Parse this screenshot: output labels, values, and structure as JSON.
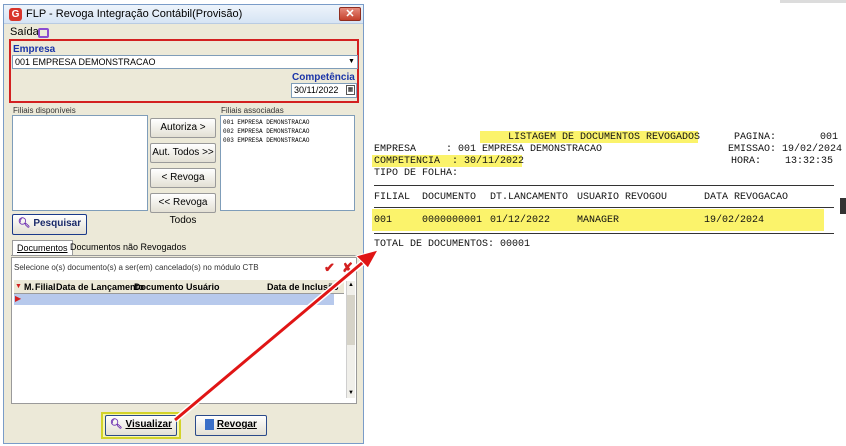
{
  "window": {
    "logo_letter": "G",
    "title": "FLP - Revoga Integração Contábil(Provisão)",
    "close_glyph": "✕",
    "menu_saida": "Saída"
  },
  "empresa": {
    "label": "Empresa",
    "value": "001 EMPRESA DEMONSTRACAO",
    "competencia_label": "Competência",
    "competencia_value": "30/11/2022"
  },
  "filiais": {
    "disponiveis_label": "Filiais disponíveis",
    "associadas_label": "Filiais associadas",
    "associadas": [
      "001 EMPRESA DEMONSTRACAO",
      "002 EMPRESA DEMONSTRACAO",
      "003 EMPRESA DEMONSTRACAO"
    ],
    "buttons": {
      "autoriza": "Autoriza >",
      "aut_todos": "Aut. Todos >>",
      "revoga": "< Revoga",
      "revoga_todos": "<< Revoga Todos"
    }
  },
  "pesquisar_label": "Pesquisar",
  "tabs": [
    "Documentos",
    "Documentos não Revogados"
  ],
  "grid": {
    "instruction": "Selecione o(s) documento(s) a ser(em) cancelado(s) no módulo CTB",
    "headers": [
      "M.",
      "Filial",
      "Data de Lançamento",
      "Documento",
      "Usuário",
      "Data de Inclusão"
    ]
  },
  "footer": {
    "visualizar": "Visualizar",
    "revogar": "Revogar"
  },
  "report": {
    "title": "LISTAGEM DE DOCUMENTOS REVOGADOS",
    "pagina_label": "PAGINA:",
    "pagina_value": "001",
    "empresa_line": "EMPRESA     : 001 EMPRESA DEMONSTRACAO",
    "emissao": "EMISSAO: 19/02/2024",
    "competencia_line": "COMPETENCIA  : 30/11/2022",
    "hora": "HORA:    13:32:35",
    "tipo_folha": "TIPO DE FOLHA:",
    "columns": [
      "FILIAL",
      "DOCUMENTO",
      "DT.LANCAMENTO",
      "USUARIO REVOGOU",
      "DATA REVOGACAO"
    ],
    "row": [
      "001",
      "0000000001",
      "01/12/2022",
      "MANAGER",
      "19/02/2024"
    ],
    "total": "TOTAL DE DOCUMENTOS: 00001"
  }
}
